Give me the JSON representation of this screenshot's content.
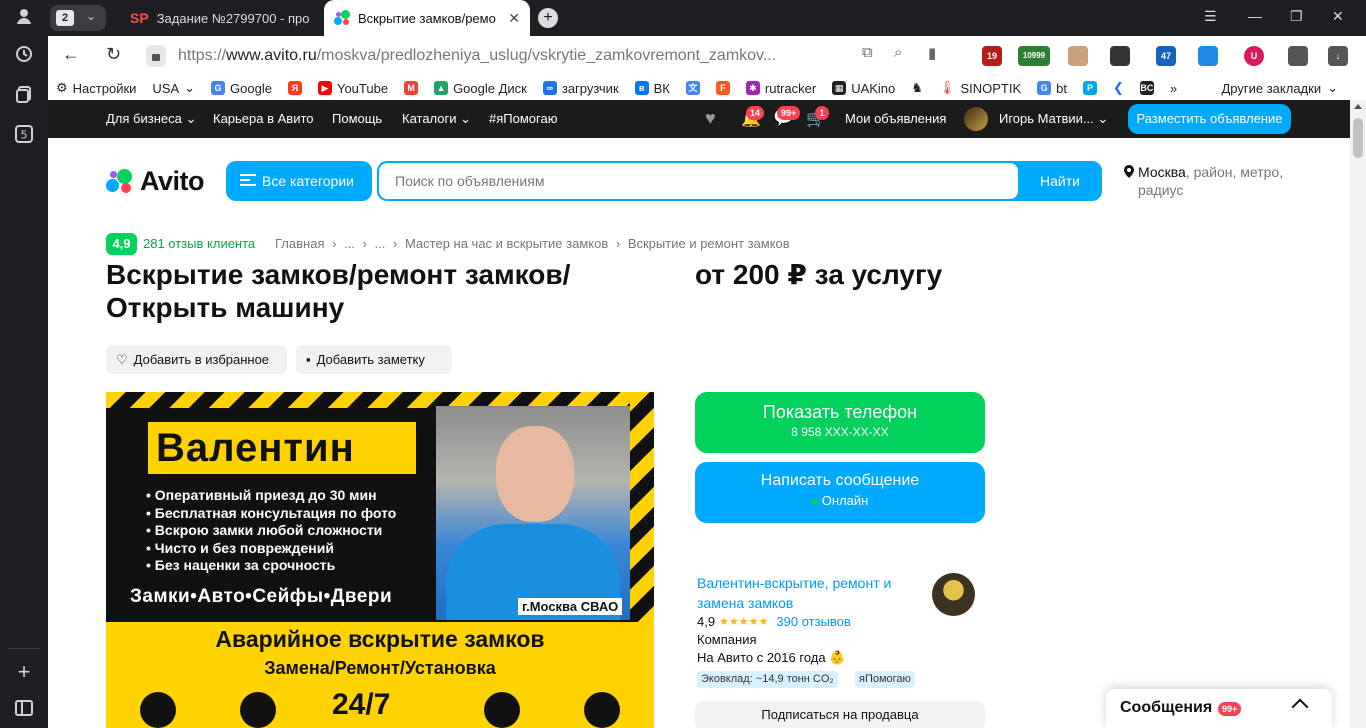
{
  "browser": {
    "tab_count": "2",
    "tabs": [
      {
        "label": "Задание №2799700 - про",
        "favicon": "SP"
      },
      {
        "label": "Вскрытие замков/ремо"
      }
    ],
    "url_prefix": "https://",
    "url_domain": "www.avito.ru",
    "url_path": "/moskva/predlozheniya_uslug/vskrytie_zamkovremont_zamkov...",
    "extension_badges": [
      "19",
      "10999",
      "47"
    ],
    "bookmarks": [
      {
        "label": "Настройки",
        "icon": "gear-icon"
      },
      {
        "label": "USA",
        "icon": "dropdown-icon"
      },
      {
        "label": "Google",
        "icon": "google-icon",
        "color": "#4285f4"
      },
      {
        "label": "",
        "icon": "yandex-icon",
        "color": "#fc3f1d"
      },
      {
        "label": "YouTube",
        "icon": "youtube-icon",
        "color": "#ff0000"
      },
      {
        "label": "",
        "icon": "gmail-icon",
        "color": "#ea4335"
      },
      {
        "label": "Google Диск",
        "icon": "drive-icon",
        "color": "#1fa463"
      },
      {
        "label": "загрузчик",
        "icon": "loader-icon",
        "color": "#1a73e8"
      },
      {
        "label": "ВК",
        "icon": "vk-icon",
        "color": "#0077ff"
      },
      {
        "label": "",
        "icon": "translate-icon",
        "color": "#4285f4"
      },
      {
        "label": "",
        "icon": "f-icon",
        "color": "#ff5722"
      },
      {
        "label": "rutracker",
        "icon": "rutracker-icon",
        "color": "#9c27b0"
      },
      {
        "label": "UAKino",
        "icon": "uakino-icon",
        "color": "#222222"
      },
      {
        "label": "",
        "icon": "chess-icon",
        "color": "#333333"
      },
      {
        "label": "SINOPTIK",
        "icon": "thermometer-icon",
        "color": "#e53935"
      },
      {
        "label": "bt",
        "icon": "google-icon",
        "color": "#4285f4"
      },
      {
        "label": "",
        "icon": "p-icon",
        "color": "#00a8e8"
      },
      {
        "label": "",
        "icon": "arrow-icon",
        "color": "#2962ff"
      },
      {
        "label": "",
        "icon": "bc-icon",
        "color": "#222222"
      }
    ],
    "bookmarks_more": "»",
    "other_bookmarks": "Другие закладки"
  },
  "avito_nav": {
    "links": [
      "Для бизнеса",
      "Карьера в Авито",
      "Помощь",
      "Каталоги",
      "#яПомогаю"
    ],
    "notifications_badge": "14",
    "messages_badge": "99+",
    "cart_badge": "1",
    "my_ads": "Мои объявления",
    "user_name": "Игорь Матвии...",
    "post_button": "Разместить объявление"
  },
  "header": {
    "logo_text": "Avito",
    "categories_button": "Все категории",
    "search_placeholder": "Поиск по объявлениям",
    "search_button": "Найти",
    "location_city": "Москва",
    "location_rest": ", район, метро, радиус"
  },
  "listing": {
    "rating": "4,9",
    "reviews_link": "281 отзыв клиента",
    "breadcrumbs": [
      "Главная",
      "›",
      "...",
      "›",
      "...",
      "›",
      "Мастер на час и вскрытие замков",
      "›",
      "Вскрытие и ремонт замков"
    ],
    "title": "Вскрытие замков/ремонт замков/ Открыть машину",
    "price": "от 200 ₽ за услугу",
    "favorite_button": "Добавить в избранное",
    "note_button": "Добавить заметку"
  },
  "ad_image": {
    "name": "Валентин",
    "bullets": [
      "• Оперативный приезд до 30 мин",
      "• Бесплатная консультация по фото",
      "• Вскрою замки любой сложности",
      "• Чисто и без повреждений",
      "• Без наценки за срочность"
    ],
    "categories": "Замки•Авто•Сейфы•Двери",
    "city": "г.Москва СВАО",
    "band_title": "Аварийное вскрытие замков",
    "band_subtitle": "Замена/Ремонт/Установка",
    "band_hours": "24/7"
  },
  "contact": {
    "phone_button": "Показать телефон",
    "phone_masked": "8 958 XXX-XX-XX",
    "message_button": "Написать сообщение",
    "online_status": "Онлайн"
  },
  "seller": {
    "name": "Валентин-вскрытие, ремонт и замена замков",
    "rating": "4,9",
    "stars": "★★★★★",
    "reviews": "390 отзывов",
    "type": "Компания",
    "since": "На Авито с 2016 года",
    "tags": [
      "Эковклад: ~14,9 тонн CO₂",
      "яПомогаю"
    ],
    "subscribe_button": "Подписаться на продавца"
  },
  "messenger": {
    "label": "Сообщения",
    "badge": "99+"
  },
  "colors": {
    "avito_blue": "#00aaff",
    "avito_green": "#02d15c",
    "badge_red": "#ff4053",
    "dark_nav": "#1b1b1b"
  }
}
